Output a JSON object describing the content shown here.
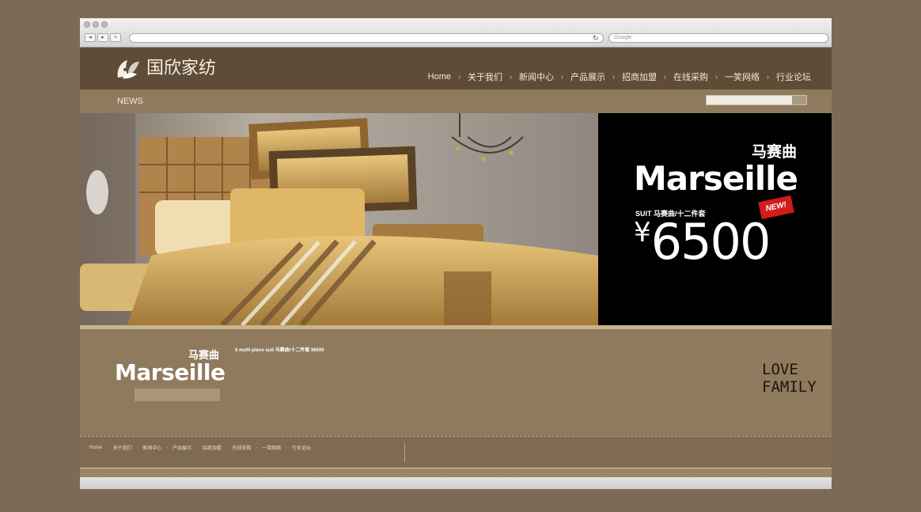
{
  "browser": {
    "back_label": "◂",
    "forward_label": "▸",
    "add_label": "+",
    "refresh_glyph": "↻",
    "search_placeholder": "Google"
  },
  "site": {
    "logo_text": "国欣家纺",
    "nav": [
      "Home",
      "关于我们",
      "新闻中心",
      "产品展示",
      "招商加盟",
      "在线采购",
      "一笑网络",
      "行业论坛"
    ],
    "news_label": "NEWS"
  },
  "banner": {
    "cn_title": "马赛曲",
    "title": "Marseille",
    "suit_label": "SUIT  马赛曲/十二件套",
    "new_badge": "NEW!",
    "currency": "¥",
    "price": "6500"
  },
  "content": {
    "cn_title": "马赛曲",
    "title": "Marseille",
    "headline": "5 multi-piece suit  马赛曲/十二件套  ¥6500",
    "love_family": "LOVE FAMILY"
  },
  "footer": {
    "nav": [
      "Home",
      "关于我们",
      "新闻中心",
      "产品展示",
      "招商加盟",
      "在线采购",
      "一笑网络",
      "行业论坛"
    ]
  }
}
